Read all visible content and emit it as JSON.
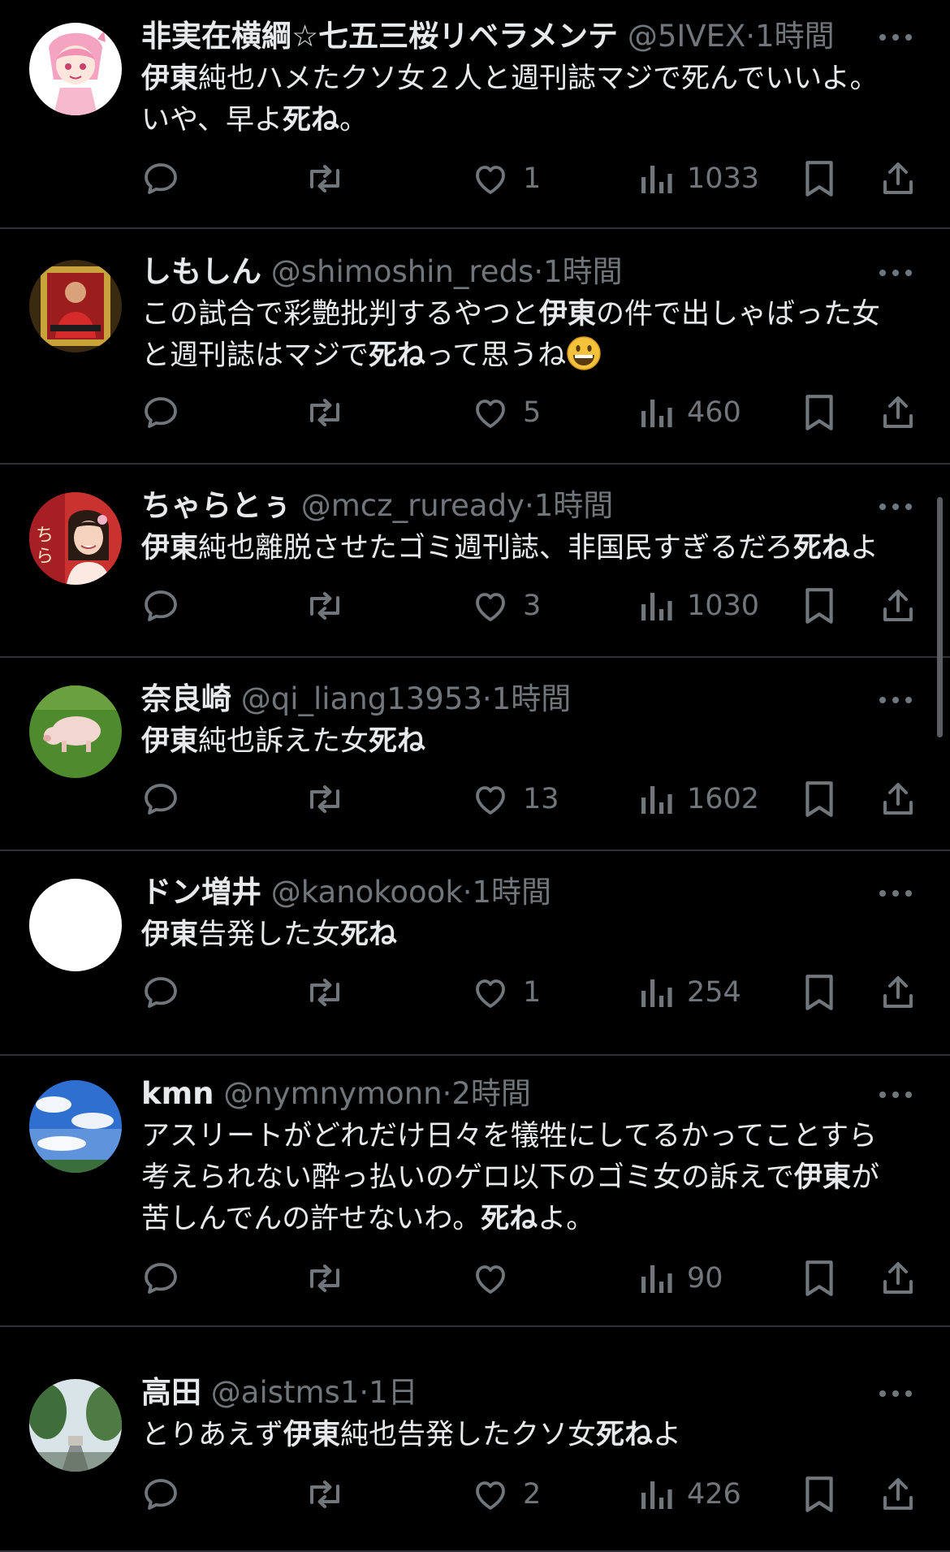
{
  "tweets": [
    {
      "name": "非実在横綱☆七五三桜リベラメンテ",
      "handle": "@5IVEX",
      "dot": "·",
      "time": "1時間",
      "text_parts": [
        {
          "t": "伊東",
          "b": true
        },
        {
          "t": "純也ハメたクソ女２人と週刊誌マジで死んでいいよ。",
          "b": false
        },
        {
          "br": true
        },
        {
          "t": "いや、早よ",
          "b": false
        },
        {
          "t": "死ね",
          "b": true
        },
        {
          "t": "。",
          "b": false
        }
      ],
      "reply": "",
      "retweet": "",
      "likes": "1",
      "views": "1033",
      "avatar_icon": "anime-girl-avatar"
    },
    {
      "name": "しもしん",
      "handle": "@shimoshin_reds",
      "dot": "·",
      "time": "1時間",
      "text_parts": [
        {
          "t": "この試合で彩艶批判するやつと",
          "b": false
        },
        {
          "t": "伊東",
          "b": true
        },
        {
          "t": "の件で出しゃばった女",
          "b": false
        },
        {
          "br": true
        },
        {
          "t": "と週刊誌はマジで",
          "b": false
        },
        {
          "t": "死ね",
          "b": true
        },
        {
          "t": "って思うね",
          "b": false
        },
        {
          "emoji": "grinning-face-emoji"
        }
      ],
      "reply": "",
      "retweet": "",
      "likes": "5",
      "views": "460",
      "avatar_icon": "soccer-player-card-avatar"
    },
    {
      "name": "ちゃらとぅ",
      "handle": "@mcz_ruready",
      "dot": "·",
      "time": "1時間",
      "text_parts": [
        {
          "t": "伊東",
          "b": true
        },
        {
          "t": "純也離脱させたゴミ週刊誌、非国民すぎるだろ",
          "b": false
        },
        {
          "t": "死ね",
          "b": true
        },
        {
          "t": "よ",
          "b": false
        }
      ],
      "reply": "",
      "retweet": "",
      "likes": "3",
      "views": "1030",
      "avatar_icon": "idol-photo-avatar"
    },
    {
      "name": "奈良崎",
      "handle": "@qi_liang13953",
      "dot": "·",
      "time": "1時間",
      "text_parts": [
        {
          "t": "伊東",
          "b": true
        },
        {
          "t": "純也訴えた女",
          "b": false
        },
        {
          "t": "死ね",
          "b": true
        }
      ],
      "reply": "",
      "retweet": "",
      "likes": "13",
      "views": "1602",
      "avatar_icon": "pig-on-grass-avatar"
    },
    {
      "name": "ドン増井",
      "handle": "@kanokoook",
      "dot": "·",
      "time": "1時間",
      "text_parts": [
        {
          "t": "伊東",
          "b": true
        },
        {
          "t": "告発した女",
          "b": false
        },
        {
          "t": "死ね",
          "b": true
        }
      ],
      "reply": "",
      "retweet": "",
      "likes": "1",
      "views": "254",
      "avatar_icon": "blank-white-avatar"
    },
    {
      "name": "kmn",
      "handle": "@nymnymonn",
      "dot": "·",
      "time": "2時間",
      "text_parts": [
        {
          "t": "アスリートがどれだけ日々を犠牲にしてるかってことすら",
          "b": false
        },
        {
          "br": true
        },
        {
          "t": "考えられない酔っ払いのゲロ以下のゴミ女の訴えで",
          "b": false
        },
        {
          "t": "伊東",
          "b": true
        },
        {
          "t": "が",
          "b": false
        },
        {
          "br": true
        },
        {
          "t": "苦しんでんの許せないわ。",
          "b": false
        },
        {
          "t": "死ね",
          "b": true
        },
        {
          "t": "よ。",
          "b": false
        }
      ],
      "reply": "",
      "retweet": "",
      "likes": "",
      "views": "90",
      "avatar_icon": "sky-clouds-avatar"
    },
    {
      "name": "高田",
      "handle": "@aistms1",
      "dot": "·",
      "time": "1日",
      "text_parts": [
        {
          "t": "とりあえず",
          "b": false
        },
        {
          "t": "伊東",
          "b": true
        },
        {
          "t": "純也告発したクソ女",
          "b": false
        },
        {
          "t": "死ね",
          "b": true
        },
        {
          "t": "よ",
          "b": false
        }
      ],
      "reply": "",
      "retweet": "",
      "likes": "2",
      "views": "426",
      "avatar_icon": "street-trees-avatar"
    }
  ],
  "icons": {
    "reply": "reply-icon",
    "retweet": "retweet-icon",
    "like": "heart-icon",
    "views": "views-chart-icon",
    "bookmark": "bookmark-icon",
    "share": "share-icon",
    "more": "more-dots-icon"
  },
  "colors": {
    "background": "#000000",
    "text": "#e7e9ea",
    "muted": "#71767b",
    "divider": "#2f3336"
  }
}
